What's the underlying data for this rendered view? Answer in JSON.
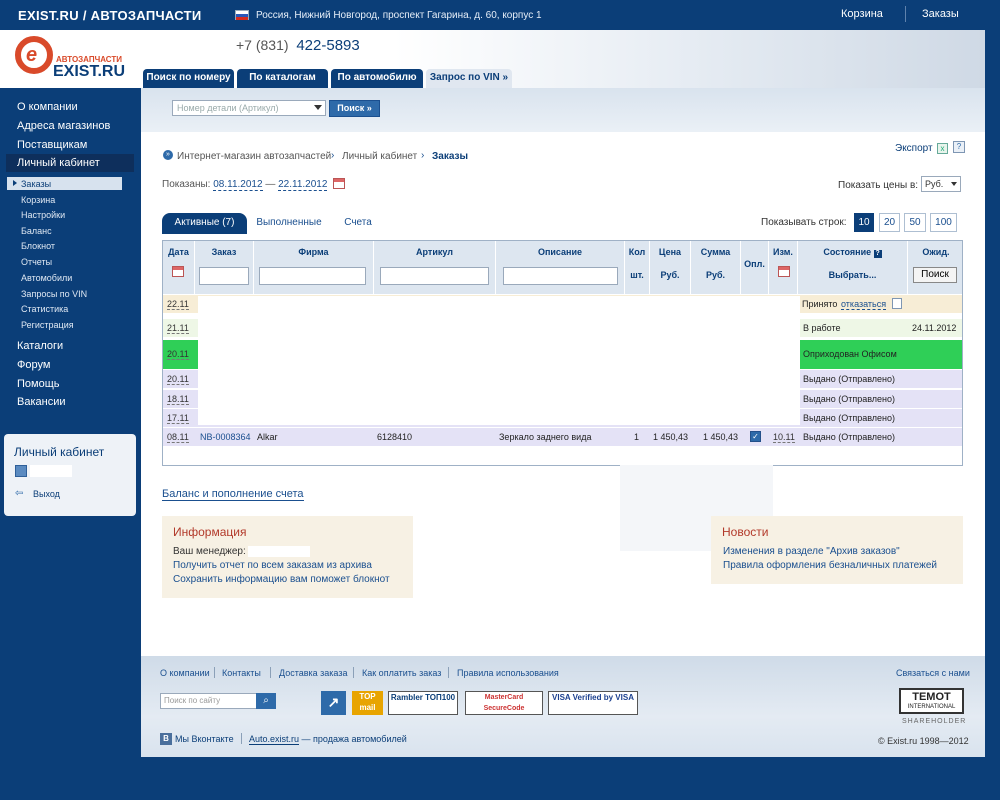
{
  "top": {
    "site_title": "EXIST.RU / АВТОЗАПЧАСТИ",
    "address": "Россия, Нижний Новгород, проспект Гагарина, д. 60, корпус 1",
    "cart": "Корзина",
    "orders": "Заказы"
  },
  "header": {
    "logo_sub": "АВТОЗАПЧАСТИ",
    "logo_text": "EXIST.RU",
    "phone_code": "+7 (831)",
    "phone_number": "422-5893",
    "tabs": [
      "Поиск по номеру",
      "По каталогам",
      "По автомобилю",
      "Запрос по VIN »"
    ]
  },
  "search": {
    "placeholder": "Номер детали (Артикул)",
    "button": "Поиск »"
  },
  "sidebar": {
    "main": [
      "О компании",
      "Адреса магазинов",
      "Поставщикам",
      "Личный кабинет"
    ],
    "sub": [
      "Заказы",
      "Корзина",
      "Настройки",
      "Баланс",
      "Блокнот",
      "Отчеты",
      "Автомобили",
      "Запросы по VIN",
      "Статистика",
      "Регистрация"
    ],
    "bottom": [
      "Каталоги",
      "Форум",
      "Помощь",
      "Вакансии"
    ],
    "lk_title": "Личный кабинет",
    "exit": "Выход"
  },
  "breadcrumb": [
    "Интернет-магазин автозапчастей",
    "Личный кабинет",
    "Заказы"
  ],
  "export": "Экспорт",
  "period": {
    "label": "Показаны:",
    "from": "08.11.2012",
    "dash": "—",
    "to": "22.11.2012"
  },
  "price": {
    "label": "Показать цены в:",
    "currency": "Руб."
  },
  "subtabs": [
    "Активные (7)",
    "Выполненные",
    "Счета"
  ],
  "rows": {
    "label": "Показывать строк:",
    "options": [
      "10",
      "20",
      "50",
      "100"
    ]
  },
  "table": {
    "headers": [
      "Дата",
      "Заказ",
      "Фирма",
      "Артикул",
      "Описание",
      "Кол",
      "Цена",
      "Сумма",
      "Опл.",
      "Изм.",
      "Состояние",
      "Ожид."
    ],
    "sub": {
      "qty": "шт.",
      "price": "Руб.",
      "sum": "Руб.",
      "state": "Выбрать...",
      "search": "Поиск",
      "help": "?"
    },
    "rows": [
      {
        "date": "22.11",
        "state": "Принято",
        "action": "отказаться",
        "color": "#f7edd6"
      },
      {
        "date": "21.11",
        "state": "В работе",
        "expected": "24.11.2012",
        "color": "#eef7e6"
      },
      {
        "date": "20.11",
        "state": "Оприходован Офисом",
        "color": "#2fcf57"
      },
      {
        "date": "20.11",
        "state": "Выдано (Отправлено)",
        "color": "#e4e2f6"
      },
      {
        "date": "18.11",
        "state": "Выдано (Отправлено)",
        "color": "#e4e2f6"
      },
      {
        "date": "17.11",
        "state": "Выдано (Отправлено)",
        "color": "#e4e2f6"
      },
      {
        "date": "08.11",
        "order": "NB-0008364",
        "firm": "Alkar",
        "article": "6128410",
        "description": "Зеркало заднего вида",
        "qty": "1",
        "price": "1 450,43",
        "sum": "1 450,43",
        "changed": "10.11",
        "state": "Выдано (Отправлено)",
        "color": "#e4e2f6"
      }
    ]
  },
  "balance_link": "Баланс и пополнение счета",
  "info": {
    "title": "Информация",
    "manager": "Ваш менеджер:",
    "line2": "Получить отчет по всем заказам из архива",
    "line3": "Сохранить информацию вам поможет блокнот"
  },
  "news": {
    "title": "Новости",
    "items": [
      "Изменения в разделе \"Архив заказов\"",
      "Правила оформления безналичных платежей"
    ]
  },
  "footer": {
    "links": [
      "О компании",
      "Контакты",
      "Доставка заказа",
      "Как оплатить заказ",
      "Правила использования"
    ],
    "contact": "Связаться с нами",
    "search_placeholder": "Поиск по сайту",
    "badges": [
      "TOP mail",
      "Rambler ТОП100",
      "MasterCard SecureCode",
      "VISA Verified by VISA"
    ],
    "temot": "TEMOT",
    "temot_sub": "INTERNATIONAL",
    "shareholder": "SHAREHOLDER",
    "vk": "Мы Вконтакте",
    "auto_link": "Auto.exist.ru",
    "auto_rest": " — продажа автомобилей",
    "copyright": "© Exist.ru 1998—2012"
  },
  "colors": {
    "brand": "#0b3e78",
    "accent": "#d94a2a",
    "link": "#1a4f8f",
    "received": "#2fcf57"
  }
}
